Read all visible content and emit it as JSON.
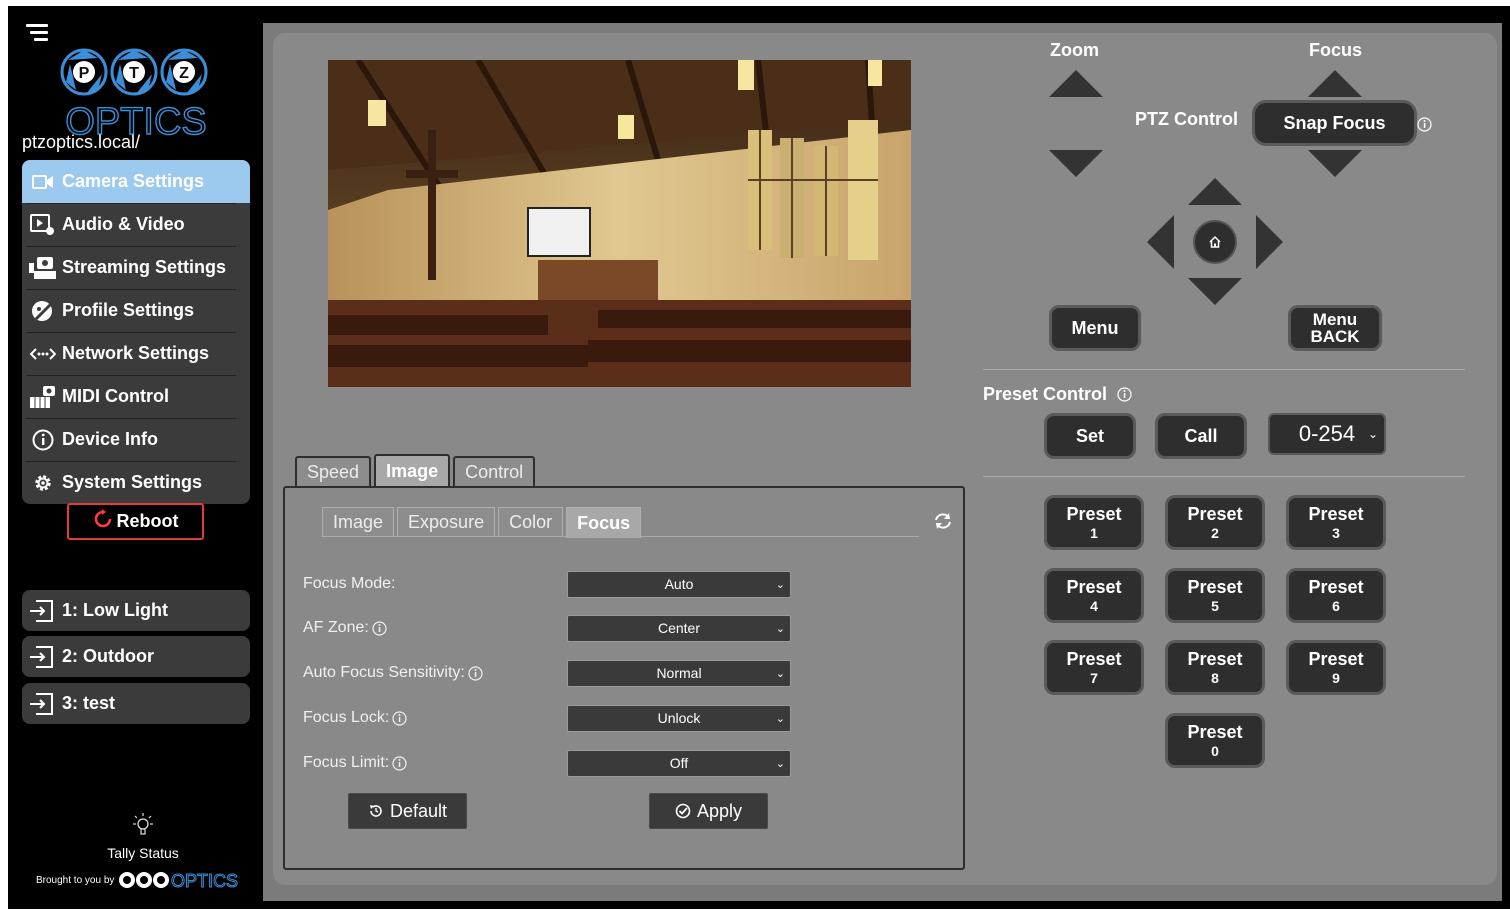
{
  "sidebar": {
    "host": "ptzoptics.local/",
    "logo_text": "OPTICS",
    "logo_letters": [
      "P",
      "T",
      "Z"
    ],
    "nav": [
      {
        "label": "Camera Settings",
        "icon": "camera-icon",
        "active": true
      },
      {
        "label": "Audio & Video",
        "icon": "audio-video-icon",
        "active": false
      },
      {
        "label": "Streaming Settings",
        "icon": "streaming-icon",
        "active": false
      },
      {
        "label": "Profile Settings",
        "icon": "profile-icon",
        "active": false
      },
      {
        "label": "Network Settings",
        "icon": "network-icon",
        "active": false
      },
      {
        "label": "MIDI Control",
        "icon": "midi-icon",
        "active": false
      },
      {
        "label": "Device Info",
        "icon": "info-icon",
        "active": false
      },
      {
        "label": "System Settings",
        "icon": "gear-icon",
        "active": false
      }
    ],
    "reboot_label": "Reboot",
    "profiles": [
      {
        "label": "1: Low Light"
      },
      {
        "label": "2: Outdoor"
      },
      {
        "label": "3: test"
      }
    ],
    "tally_label": "Tally Status",
    "brought_by": "Brought to you by",
    "brought_logo_text": "OPTICS"
  },
  "main_tabs": [
    {
      "label": "Speed",
      "active": false
    },
    {
      "label": "Image",
      "active": true
    },
    {
      "label": "Control",
      "active": false
    }
  ],
  "sub_tabs": [
    {
      "label": "Image",
      "active": false
    },
    {
      "label": "Exposure",
      "active": false
    },
    {
      "label": "Color",
      "active": false
    },
    {
      "label": "Focus",
      "active": true
    }
  ],
  "focus_settings": [
    {
      "label": "Focus Mode:",
      "value": "Auto",
      "info": false
    },
    {
      "label": "AF Zone:",
      "value": "Center",
      "info": true
    },
    {
      "label": "Auto Focus Sensitivity:",
      "value": "Normal",
      "info": true
    },
    {
      "label": "Focus Lock:",
      "value": "Unlock",
      "info": true
    },
    {
      "label": "Focus Limit:",
      "value": "Off",
      "info": true
    }
  ],
  "buttons": {
    "default_label": "Default",
    "apply_label": "Apply"
  },
  "ptz": {
    "zoom_label": "Zoom",
    "focus_label": "Focus",
    "ptz_control_label": "PTZ Control",
    "snap_focus_label": "Snap Focus",
    "menu_label": "Menu",
    "menu_back_line1": "Menu",
    "menu_back_line2": "BACK"
  },
  "presets": {
    "title": "Preset Control",
    "set_label": "Set",
    "call_label": "Call",
    "range_value": "0-254",
    "items": [
      {
        "label": "Preset",
        "num": "1"
      },
      {
        "label": "Preset",
        "num": "2"
      },
      {
        "label": "Preset",
        "num": "3"
      },
      {
        "label": "Preset",
        "num": "4"
      },
      {
        "label": "Preset",
        "num": "5"
      },
      {
        "label": "Preset",
        "num": "6"
      },
      {
        "label": "Preset",
        "num": "7"
      },
      {
        "label": "Preset",
        "num": "8"
      },
      {
        "label": "Preset",
        "num": "9"
      },
      {
        "label": "Preset",
        "num": "0"
      }
    ]
  },
  "colors": {
    "sidebar_active": "#9cc9ee",
    "logo_blue": "#3a8fd8",
    "reboot_red": "#e23b3b",
    "panel_bg": "#898989",
    "button_dark": "#2e2e2e"
  }
}
